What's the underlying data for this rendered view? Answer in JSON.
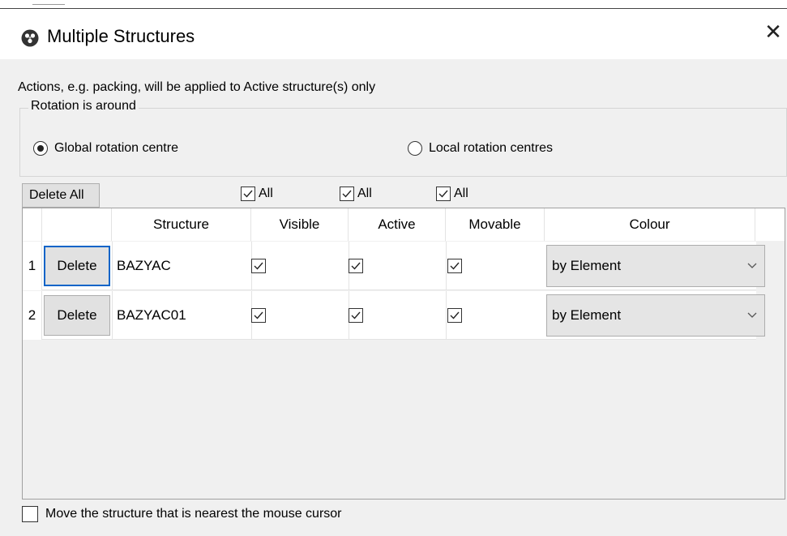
{
  "window": {
    "title": "Multiple Structures",
    "close_glyph": "✕",
    "icon": "app-orb-icon"
  },
  "info_text": "Actions, e.g. packing, will be applied to Active structure(s) only",
  "rotation": {
    "legend": "Rotation is around",
    "options": [
      {
        "label": "Global rotation centre",
        "selected": true
      },
      {
        "label": "Local rotation centres",
        "selected": false
      }
    ]
  },
  "toolbar": {
    "delete_all_label": "Delete All",
    "all_toggles": [
      {
        "label": "All",
        "checked": true
      },
      {
        "label": "All",
        "checked": true
      },
      {
        "label": "All",
        "checked": true
      }
    ]
  },
  "table": {
    "columns": [
      "Structure",
      "Visible",
      "Active",
      "Movable",
      "Colour"
    ],
    "rows": [
      {
        "num": "1",
        "delete_label": "Delete",
        "structure": "BAZYAC",
        "visible": true,
        "active": true,
        "movable": true,
        "colour": "by Element"
      },
      {
        "num": "2",
        "delete_label": "Delete",
        "structure": "BAZYAC01",
        "visible": true,
        "active": true,
        "movable": true,
        "colour": "by Element"
      }
    ]
  },
  "nearest_cursor": {
    "label": "Move the structure that is nearest the mouse cursor",
    "checked": false
  },
  "colors": {
    "focus_border": "#0a64c8",
    "dialog_bg": "#f0f0f0"
  }
}
